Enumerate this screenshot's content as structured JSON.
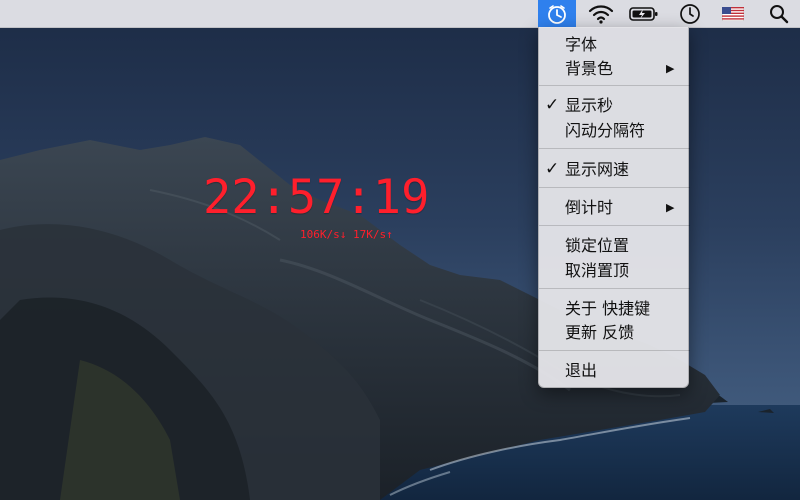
{
  "menubar": {
    "items": [
      {
        "icon": "clock-app-icon",
        "active": true
      },
      {
        "icon": "wifi-icon"
      },
      {
        "icon": "battery-charging-icon"
      },
      {
        "icon": "time-machine-clock-icon"
      },
      {
        "icon": "us-flag-input-source-icon"
      },
      {
        "icon": "spotlight-search-icon"
      }
    ],
    "accent": "#2f80ed"
  },
  "desktop_clock": {
    "time": "22:57:19",
    "speed": "106K/s↓ 17K/s↑",
    "color": "#ff1f2c"
  },
  "menu": {
    "font": "字体",
    "background_color": "背景色",
    "show_seconds": "显示秒",
    "show_seconds_checked": true,
    "blink_separator": "闪动分隔符",
    "show_net_speed": "显示网速",
    "show_net_speed_checked": true,
    "countdown": "倒计时",
    "lock_position": "锁定位置",
    "unpin_top": "取消置顶",
    "about_shortcuts": "关于 快捷键",
    "update_feedback": "更新 反馈",
    "quit": "退出",
    "checkmark": "✓",
    "submenu_arrow": "▶"
  }
}
